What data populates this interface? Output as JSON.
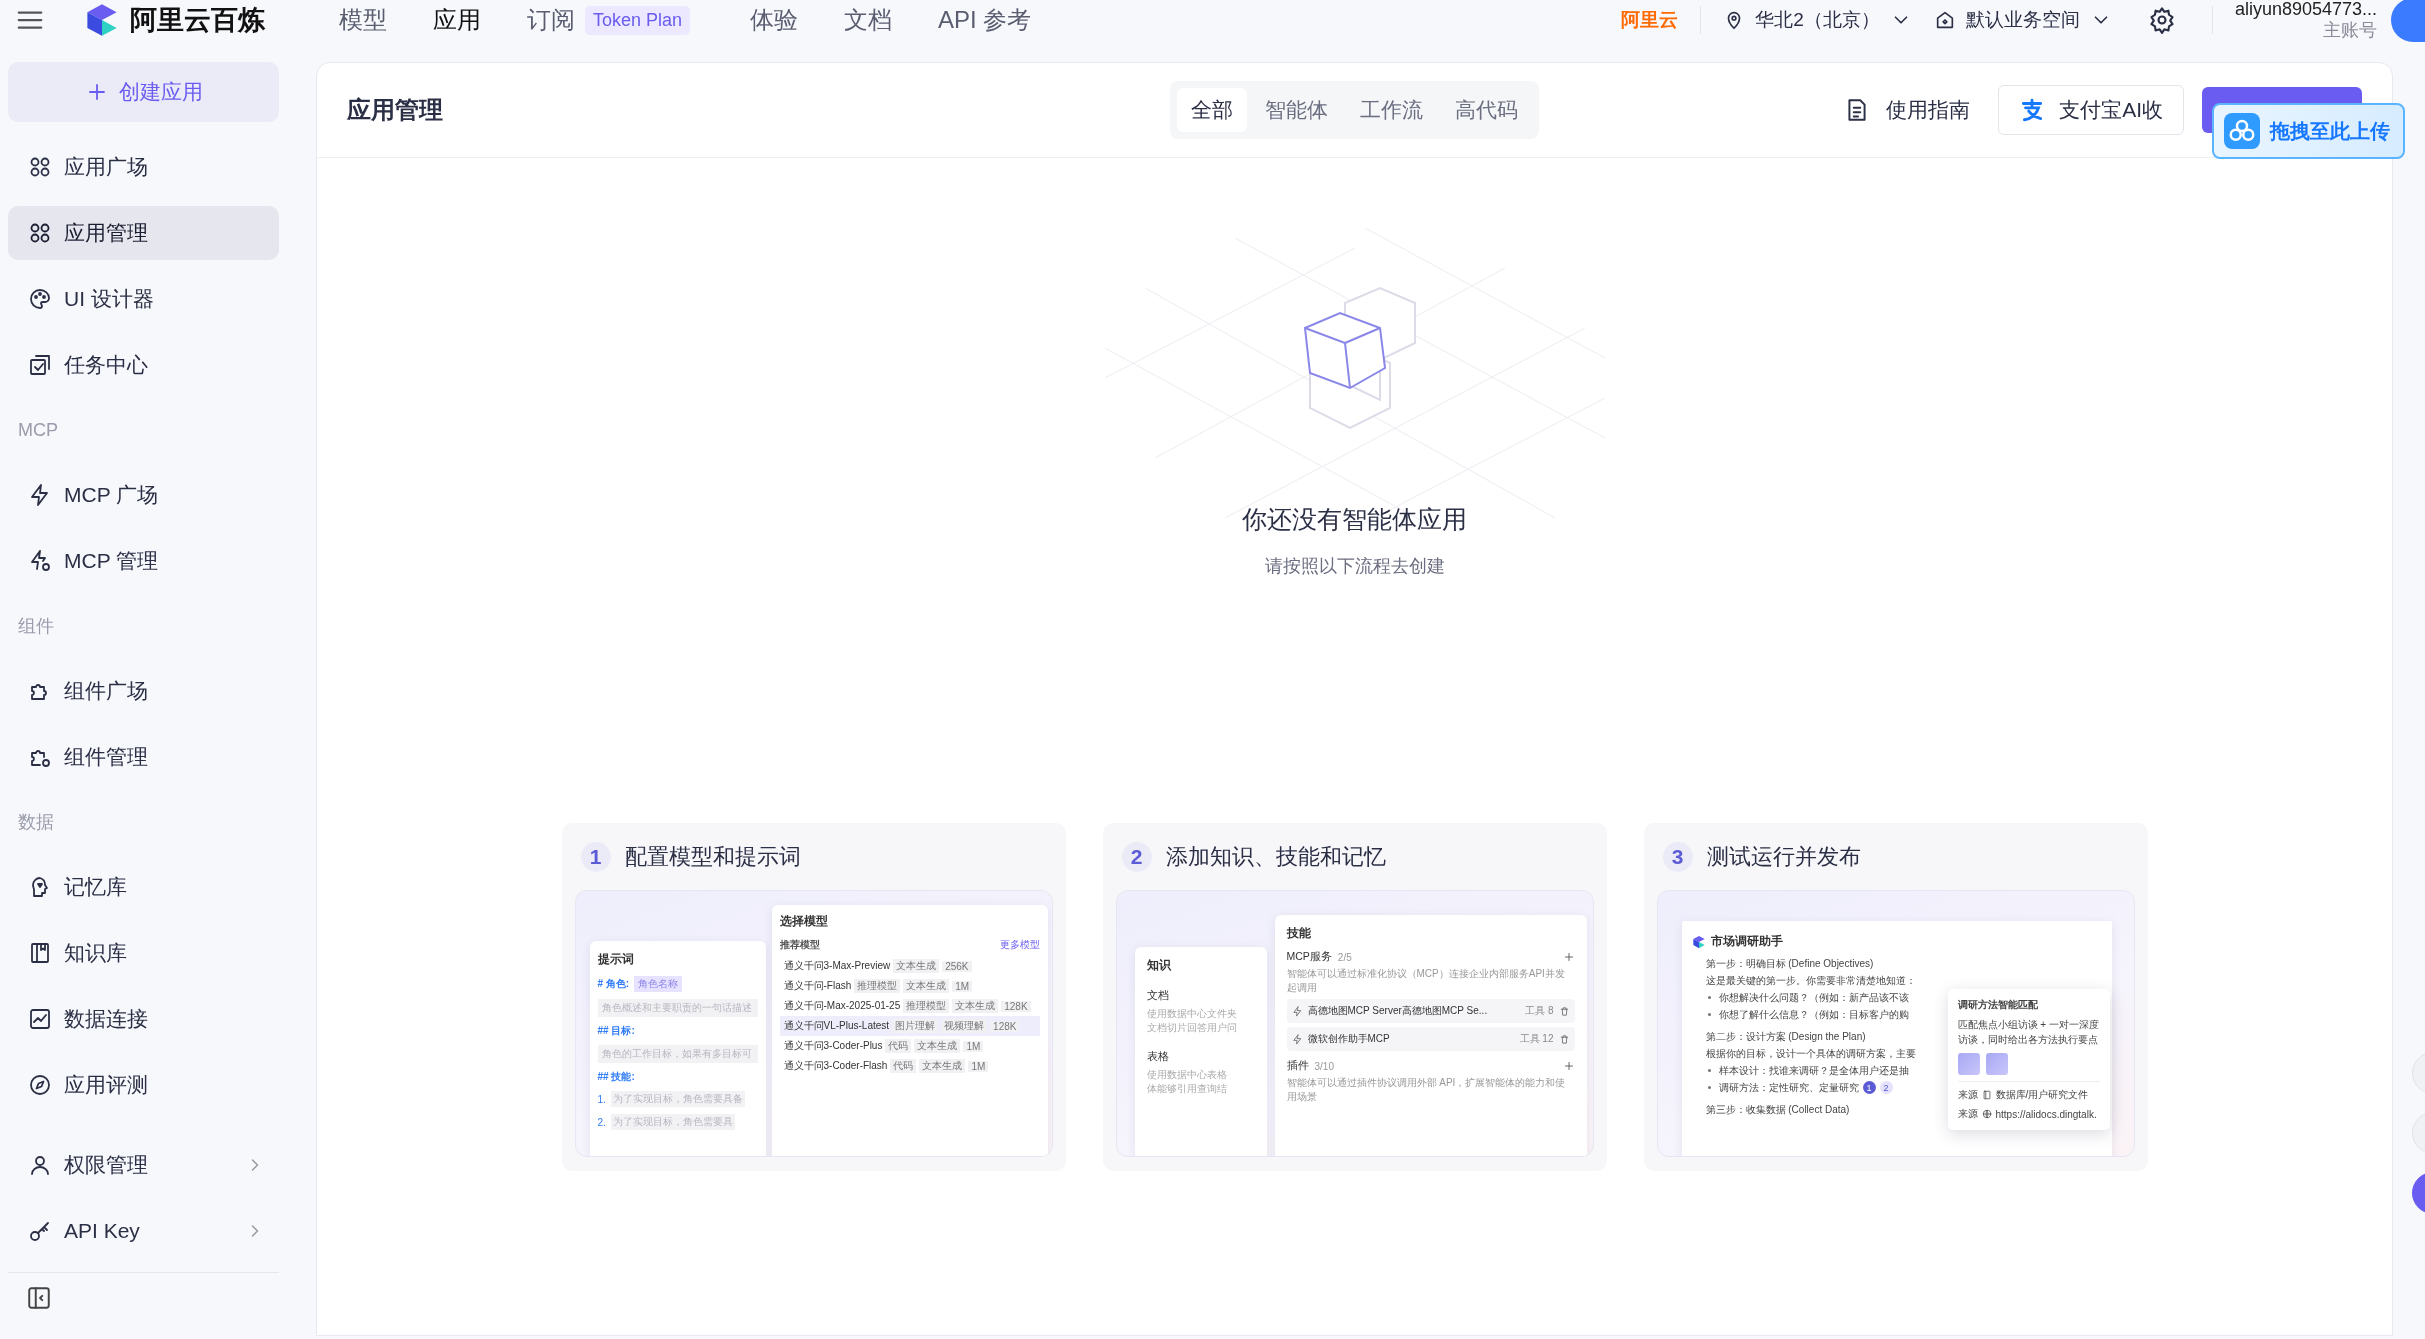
{
  "topbar": {
    "brand": "阿里云百炼",
    "nav": [
      {
        "label": "模型",
        "selected": false
      },
      {
        "label": "应用",
        "selected": true
      },
      {
        "label": "订阅",
        "selected": false,
        "badge": "Token Plan"
      },
      {
        "label": "体验",
        "selected": false
      },
      {
        "label": "文档",
        "selected": false
      },
      {
        "label": "API 参考",
        "selected": false
      }
    ],
    "cloud_logo": "阿里云",
    "region": "华北2（北京）",
    "workspace": "默认业务空间",
    "user": "aliyun89054773...",
    "account_type": "主账号"
  },
  "sidebar": {
    "create_button": "创建应用",
    "sections": [
      {
        "items": [
          {
            "label": "应用广场",
            "selected": false,
            "kind": "link"
          },
          {
            "label": "应用管理",
            "selected": true,
            "kind": "link"
          },
          {
            "label": "UI 设计器",
            "selected": false,
            "kind": "link"
          },
          {
            "label": "任务中心",
            "selected": false,
            "kind": "link"
          }
        ]
      },
      {
        "heading": "MCP",
        "items": [
          {
            "label": "MCP 广场",
            "selected": false,
            "kind": "link"
          },
          {
            "label": "MCP 管理",
            "selected": false,
            "kind": "link"
          }
        ]
      },
      {
        "heading": "组件",
        "items": [
          {
            "label": "组件广场",
            "selected": false,
            "kind": "link"
          },
          {
            "label": "组件管理",
            "selected": false,
            "kind": "link"
          }
        ]
      },
      {
        "heading": "数据",
        "items": [
          {
            "label": "记忆库",
            "selected": false,
            "kind": "link"
          },
          {
            "label": "知识库",
            "selected": false,
            "kind": "link"
          },
          {
            "label": "数据连接",
            "selected": false,
            "kind": "link"
          },
          {
            "label": "应用评测",
            "selected": false,
            "kind": "link"
          }
        ]
      },
      {
        "items": [
          {
            "label": "权限管理",
            "selected": false,
            "kind": "group"
          },
          {
            "label": "API Key",
            "selected": false,
            "kind": "group"
          }
        ]
      }
    ]
  },
  "main": {
    "title": "应用管理",
    "filters": [
      {
        "label": "全部",
        "selected": true
      },
      {
        "label": "智能体",
        "selected": false
      },
      {
        "label": "工作流",
        "selected": false
      },
      {
        "label": "高代码",
        "selected": false
      }
    ],
    "guide": "使用指南",
    "alipay": "支付宝AI收",
    "upload_overlay": "拖拽至此上传",
    "empty": {
      "title": "你还没有智能体应用",
      "subtitle": "请按照以下流程去创建"
    },
    "steps": [
      {
        "number": "1",
        "title": "配置模型和提示词",
        "preview": {
          "kind": "prompt",
          "prompt_card": {
            "title": "提示词",
            "lines": [
              {
                "kind": "heading",
                "text": "# 角色:",
                "tag": "角色名称"
              },
              {
                "kind": "hint",
                "text": "角色概述和主要职责的一句话描述"
              },
              {
                "kind": "heading",
                "text": "## 目标:"
              },
              {
                "kind": "hint",
                "text": "角色的工作目标，如果有多目标可"
              },
              {
                "kind": "heading",
                "text": "## 技能:"
              },
              {
                "kind": "list",
                "number": "1.",
                "text": "为了实现目标，角色需要具备"
              },
              {
                "kind": "list",
                "number": "2.",
                "text": "为了实现目标，角色需要具"
              }
            ]
          },
          "model_card": {
            "title": "选择模型",
            "section": "推荐模型",
            "more": "更多模型",
            "models": [
              {
                "name": "通义千问3-Max-Preview",
                "tags": [
                  "文本生成",
                  "256K"
                ],
                "selected": false
              },
              {
                "name": "通义千问-Flash",
                "tags": [
                  "推理模型",
                  "文本生成",
                  "1M"
                ],
                "selected": false
              },
              {
                "name": "通义千问-Max-2025-01-25",
                "tags": [
                  "推理模型",
                  "文本生成",
                  "128K"
                ],
                "selected": false
              },
              {
                "name": "通义千问VL-Plus-Latest",
                "tags": [
                  "图片理解",
                  "视频理解",
                  "128K"
                ],
                "selected": true
              },
              {
                "name": "通义千问3-Coder-Plus",
                "tags": [
                  "代码",
                  "文本生成",
                  "1M"
                ],
                "selected": false
              },
              {
                "name": "通义千问3-Coder-Flash",
                "tags": [
                  "代码",
                  "文本生成",
                  "1M"
                ],
                "selected": false
              }
            ]
          }
        }
      },
      {
        "number": "2",
        "title": "添加知识、技能和记忆",
        "preview": {
          "kind": "skills",
          "knowledge_card": {
            "title": "知识",
            "sections": [
              {
                "title": "文档",
                "lines": [
                  "使用数据中心文件夹",
                  "文档切片回答用户问"
                ]
              },
              {
                "title": "表格",
                "lines": [
                  "使用数据中心表格",
                  "体能够引用查询结"
                ]
              }
            ]
          },
          "skills_card": {
            "title": "技能",
            "groups": [
              {
                "name": "MCP服务",
                "count": "2/5",
                "description": "智能体可以通过标准化协议（MCP）连接企业内部服务API并发起调用",
                "tools": [
                  {
                    "name": "高德地图MCP Server高德地图MCP Se...",
                    "count": "工具 8"
                  },
                  {
                    "name": "微软创作助手MCP",
                    "count": "工具 12"
                  }
                ]
              },
              {
                "name": "插件",
                "count": "3/10",
                "description": "智能体可以通过插件协议调用外部 API，扩展智能体的能力和使用场景"
              }
            ]
          }
        }
      },
      {
        "number": "3",
        "title": "测试运行并发布",
        "preview": {
          "kind": "chat",
          "title": "市场调研助手",
          "blocks": [
            {
              "kind": "heading",
              "text": "第一步：明确目标 (Define Objectives)"
            },
            {
              "kind": "text",
              "text": "这是最关键的第一步。你需要非常清楚地知道："
            },
            {
              "kind": "bullet",
              "text": "你想解决什么问题？（例如：新产品该不该"
            },
            {
              "kind": "bullet",
              "text": "你想了解什么信息？（例如：目标客户的购"
            },
            {
              "kind": "heading",
              "text": "第二步：设计方案 (Design the Plan)"
            },
            {
              "kind": "text",
              "text": "根据你的目标，设计一个具体的调研方案，主要"
            },
            {
              "kind": "bullet",
              "text": "样本设计：找谁来调研？是全体用户还是抽"
            },
            {
              "kind": "bullet",
              "text": "调研方法：定性研究、定量研究",
              "citations": [
                "1",
                "2"
              ]
            },
            {
              "kind": "heading",
              "text": "第三步：收集数据 (Collect Data)"
            }
          ],
          "popup": {
            "title": "调研方法智能匹配",
            "text": "匹配焦点小组访谈 + 一对一深度访谈，同时给出各方法执行要点",
            "sources": [
              {
                "label": "来源",
                "kind": "file",
                "text": "数据库/用户研究文件"
              },
              {
                "label": "来源",
                "kind": "web",
                "text": "https://alidocs.dingtalk."
              }
            ]
          }
        }
      }
    ]
  }
}
